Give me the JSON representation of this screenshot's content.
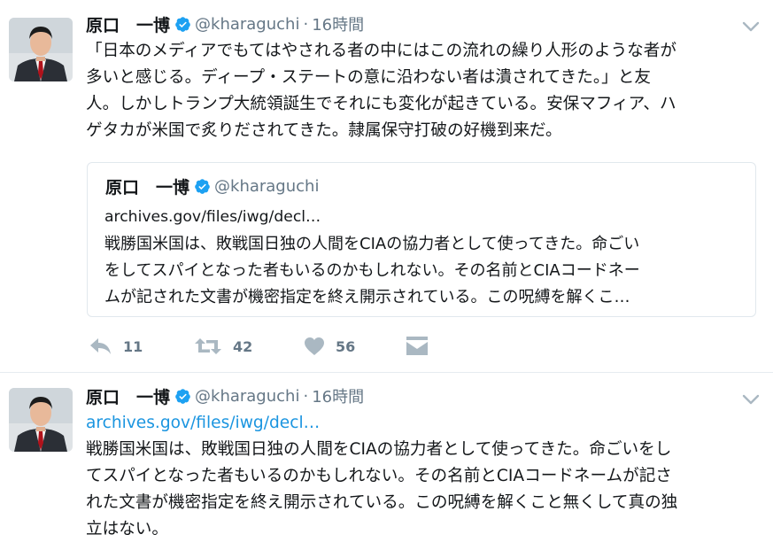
{
  "tweets": [
    {
      "author_name": "原口　一博",
      "handle": "@kharaguchi",
      "separator": "·",
      "time": "16時間",
      "text_lines": [
        "「日本のメディアでもてはやされる者の中にはこの流れの繰り人形のような者が",
        "多いと感じる。ディープ・ステートの意に沿わない者は潰されてきた。」と友",
        "人。しかしトランプ大統領誕生でそれにも変化が起きている。安保マフィア、ハ",
        "ゲタカが米国で炙りだされてきた。隷属保守打破の好機到来だ。"
      ],
      "quote": {
        "author_name": "原口　一博",
        "handle": "@kharaguchi",
        "url": "archives.gov/files/iwg/decl…",
        "text_lines": [
          "戦勝国米国は、敗戦国日独の人間をCIAの協力者として使ってきた。命ごい",
          "をしてスパイとなった者もいるのかもしれない。その名前とCIAコードネー",
          "ムが記された文書が機密指定を終え開示されている。この呪縛を解くこ…"
        ]
      },
      "actions": {
        "reply_count": "11",
        "retweet_count": "42",
        "like_count": "56"
      }
    },
    {
      "author_name": "原口　一博",
      "handle": "@kharaguchi",
      "separator": "·",
      "time": "16時間",
      "link": "archives.gov/files/iwg/decl…",
      "text_lines": [
        "戦勝国米国は、敗戦国日独の人間をCIAの協力者として使ってきた。命ごいをし",
        "てスパイとなった者もいるのかもしれない。その名前とCIAコードネームが記さ",
        "れた文書が機密指定を終え開示されている。この呪縛を解くこと無くして真の独",
        "立はない。"
      ]
    }
  ],
  "colors": {
    "verified": "#1da1f2",
    "link": "#1b95e0",
    "muted": "#657786",
    "icon": "#aab8c2"
  },
  "icons": [
    "verified-badge-icon",
    "chevron-down-icon",
    "reply-icon",
    "retweet-icon",
    "heart-icon",
    "direct-message-icon"
  ]
}
